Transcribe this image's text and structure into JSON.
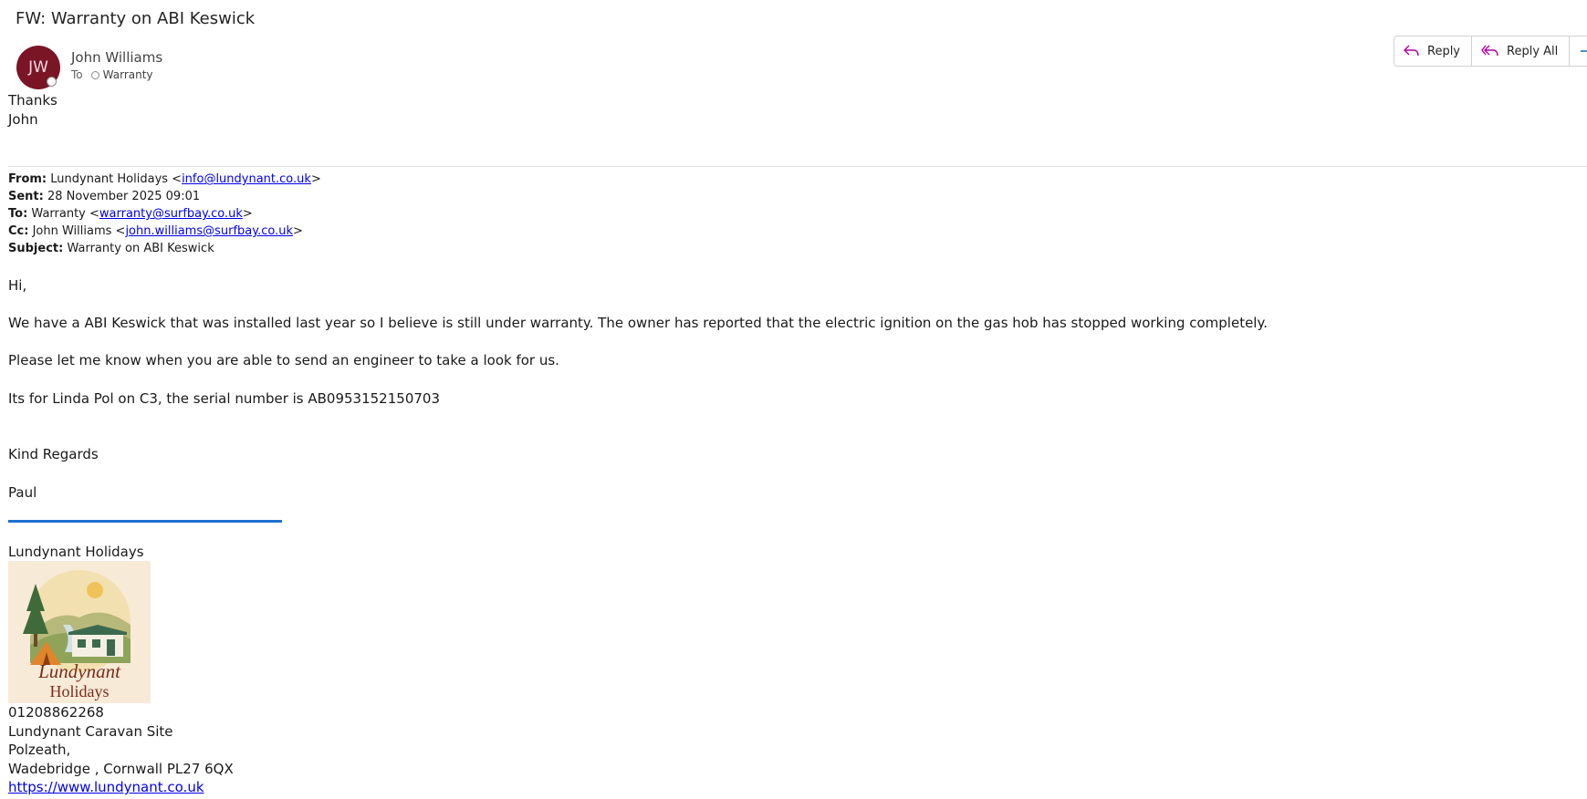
{
  "email": {
    "subject": "FW: Warranty on ABI Keswick",
    "sender_initials": "JW",
    "sender_name": "John Williams",
    "to_label": "To",
    "to_recipient": "Warranty"
  },
  "actions": {
    "reply": "Reply",
    "reply_all": "Reply All",
    "forward": "F"
  },
  "message": {
    "thanks": "Thanks",
    "signoff_name": "John"
  },
  "forwarded": {
    "from_label": "From:",
    "from_name": "Lundynant Holidays <",
    "from_email": "info@lundynant.co.uk",
    "from_close": ">",
    "sent_label": "Sent:",
    "sent_value": "28 November 2025 09:01",
    "to_label": "To:",
    "to_name": "Warranty <",
    "to_email": "warranty@surfbay.co.uk",
    "to_close": ">",
    "cc_label": "Cc:",
    "cc_name": "John Williams <",
    "cc_email": "john.williams@surfbay.co.uk",
    "cc_close": ">",
    "subject_label": "Subject:",
    "subject_value": "Warranty on ABI Keswick",
    "greeting": "Hi,",
    "para1": "We have a ABI Keswick that was installed last year so I believe is still under warranty. The owner has reported that the electric ignition on the gas hob has stopped working completely.",
    "para2": "Please let me know when you are able to send an engineer to take a look for us.",
    "para3": "Its for Linda Pol on C3, the serial number is AB0953152150703",
    "regards": "Kind Regards",
    "signer": "Paul"
  },
  "signature": {
    "company": "Lundynant Holidays",
    "logo_text_line1": "Lundynant",
    "logo_text_line2": "Holidays",
    "phone": "01208862268",
    "address1": "Lundynant Caravan Site",
    "address2": "Polzeath,",
    "address3": "Wadebridge , Cornwall PL27 6QX",
    "website": "https://www.lundynant.co.uk"
  },
  "colors": {
    "avatar_bg": "#7a1526",
    "signature_rule": "#1f6fd1",
    "link": "#0000ee",
    "reply_icon": "#b4009e",
    "forward_icon": "#0f6cbd"
  }
}
